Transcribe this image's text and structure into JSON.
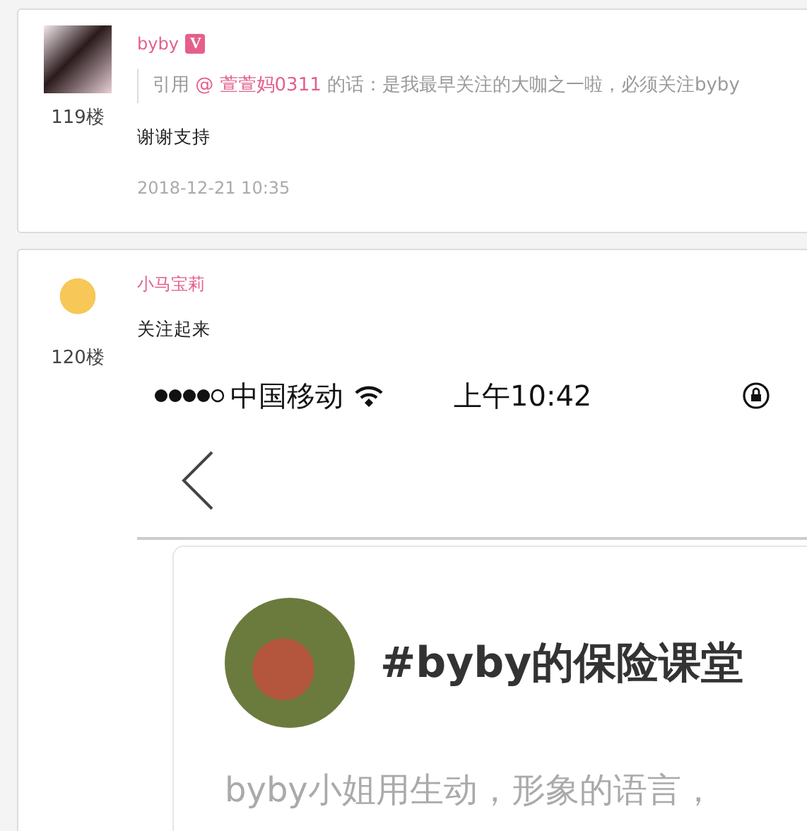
{
  "posts": [
    {
      "author": "byby",
      "badge": "V",
      "floor": "119楼",
      "quote": {
        "prefix": "引用",
        "mention": "@ 萱萱妈0311",
        "text": "的话：是我最早关注的大咖之一啦，必须关注byby"
      },
      "body": "谢谢支持",
      "time": "2018-12-21 10:35"
    },
    {
      "author": "小马宝莉",
      "floor": "120楼",
      "body": "关注起来",
      "screenshot": {
        "carrier": "中国移动",
        "clock": "上午10:42",
        "card_title": "#byby的保险课堂",
        "card_description": "byby小姐用生动，形象的语言，"
      }
    }
  ]
}
